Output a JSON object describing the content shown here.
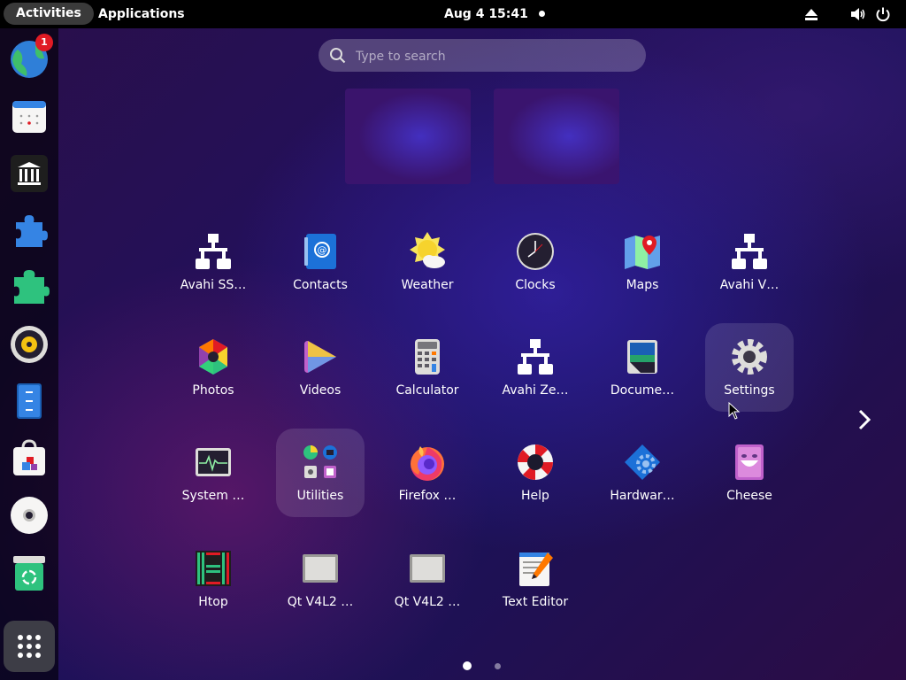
{
  "topbar": {
    "activities_label": "Activities",
    "applications_label": "Applications",
    "clock": "Aug 4  15:41",
    "tray_icons": [
      "eject-icon",
      "volume-icon",
      "power-icon"
    ]
  },
  "dash": {
    "badge_count": "1",
    "items": [
      "web-browser-icon",
      "calendar-icon",
      "archive-icon",
      "extensions-icon",
      "extension-manager-icon",
      "rhythmbox-icon",
      "files-icon",
      "software-icon",
      "disc-icon",
      "trash-icon"
    ],
    "show_apps_icon": "grid-icon"
  },
  "search": {
    "placeholder": "Type to search"
  },
  "apps": [
    {
      "label": "Avahi SS…",
      "icon": "network-icon"
    },
    {
      "label": "Contacts",
      "icon": "contacts-icon"
    },
    {
      "label": "Weather",
      "icon": "weather-icon"
    },
    {
      "label": "Clocks",
      "icon": "clock-icon"
    },
    {
      "label": "Maps",
      "icon": "maps-icon"
    },
    {
      "label": "Avahi V…",
      "icon": "network-icon"
    },
    {
      "label": "Photos",
      "icon": "photos-icon"
    },
    {
      "label": "Videos",
      "icon": "videos-icon"
    },
    {
      "label": "Calculator",
      "icon": "calculator-icon"
    },
    {
      "label": "Avahi Ze…",
      "icon": "network-icon"
    },
    {
      "label": "Docume…",
      "icon": "document-viewer-icon"
    },
    {
      "label": "Settings",
      "icon": "gear-icon"
    },
    {
      "label": "System …",
      "icon": "system-monitor-icon"
    },
    {
      "label": "Utilities",
      "icon": "folder-grid-icon"
    },
    {
      "label": "Firefox …",
      "icon": "firefox-icon"
    },
    {
      "label": "Help",
      "icon": "lifebuoy-icon"
    },
    {
      "label": "Hardwar…",
      "icon": "hardware-icon"
    },
    {
      "label": "Cheese",
      "icon": "cheese-icon"
    },
    {
      "label": "Htop",
      "icon": "htop-icon"
    },
    {
      "label": "Qt V4L2 …",
      "icon": "qt-v4l2-icon"
    },
    {
      "label": "Qt V4L2 …",
      "icon": "qt-v4l2-icon"
    },
    {
      "label": "Text Editor",
      "icon": "text-editor-icon"
    }
  ],
  "pagination": {
    "pages": 2,
    "current": 1
  },
  "colors": {
    "accent": "#3584e4",
    "badge": "#e01b24",
    "topbar": "#000000"
  }
}
